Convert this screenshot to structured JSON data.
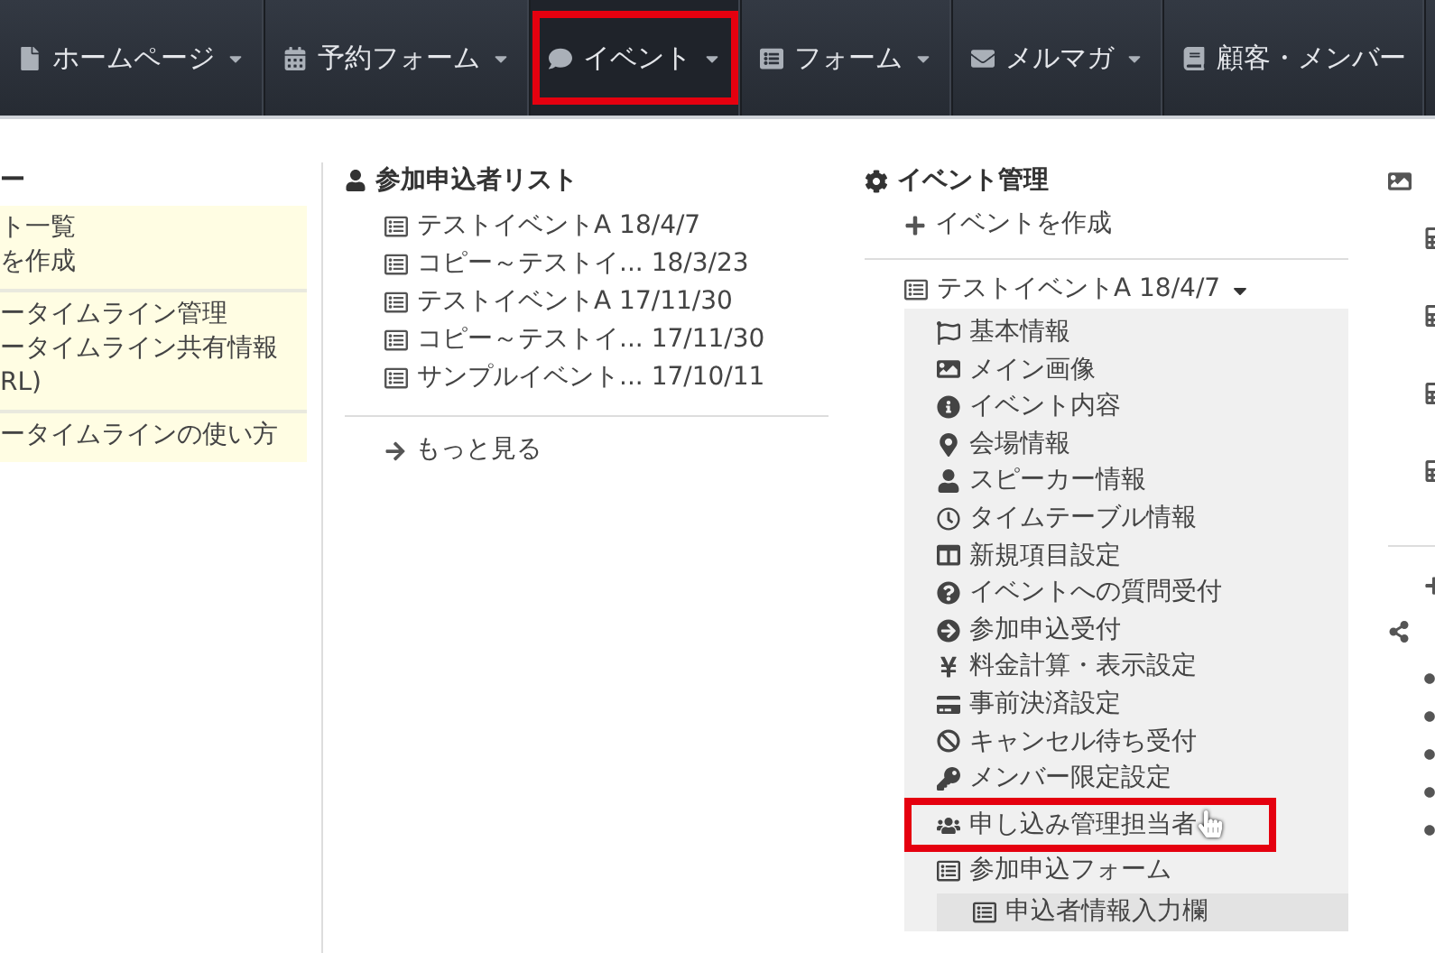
{
  "nav": {
    "items": [
      {
        "label": "ホームページ",
        "selected": false,
        "highlighted": false
      },
      {
        "label": "予約フォーム",
        "selected": false,
        "highlighted": false
      },
      {
        "label": "イベント",
        "selected": true,
        "highlighted": true
      },
      {
        "label": "フォーム",
        "selected": false,
        "highlighted": false
      },
      {
        "label": "メルマガ",
        "selected": false,
        "highlighted": false
      },
      {
        "label": "顧客・メンバー",
        "selected": false,
        "highlighted": false
      }
    ]
  },
  "left_column": {
    "heading": "ー",
    "groups": [
      [
        "ト一覧",
        "を作成"
      ],
      [
        "ータイムライン管理",
        "ータイムライン共有情報",
        "RL)"
      ],
      [
        "ータイムラインの使い方"
      ]
    ]
  },
  "applicant_list": {
    "title": "参加申込者リスト",
    "items": [
      {
        "name": "テストイベントA",
        "date": "18/4/7"
      },
      {
        "name": "コピー～テストイ...",
        "date": "18/3/23"
      },
      {
        "name": "テストイベントA",
        "date": "17/11/30"
      },
      {
        "name": "コピー～テストイ...",
        "date": "17/11/30"
      },
      {
        "name": "サンプルイベント...",
        "date": "17/10/11"
      }
    ],
    "more": "もっと見る"
  },
  "event_management": {
    "title": "イベント管理",
    "create": "イベントを作成",
    "event": {
      "label": "テストイベントA 18/4/7",
      "expanded": true,
      "items": [
        {
          "label": "基本情報",
          "highlighted": false
        },
        {
          "label": "メイン画像",
          "highlighted": false
        },
        {
          "label": "イベント内容",
          "highlighted": false
        },
        {
          "label": "会場情報",
          "highlighted": false
        },
        {
          "label": "スピーカー情報",
          "highlighted": false
        },
        {
          "label": "タイムテーブル情報",
          "highlighted": false
        },
        {
          "label": "新規項目設定",
          "highlighted": false
        },
        {
          "label": "イベントへの質問受付",
          "highlighted": false
        },
        {
          "label": "参加申込受付",
          "highlighted": false
        },
        {
          "label": "料金計算・表示設定",
          "highlighted": false
        },
        {
          "label": "事前決済設定",
          "highlighted": false
        },
        {
          "label": "キャンセル待ち受付",
          "highlighted": false
        },
        {
          "label": "メンバー限定設定",
          "highlighted": false
        },
        {
          "label": "申し込み管理担当者",
          "highlighted": true
        },
        {
          "label": "参加申込フォーム",
          "highlighted": false
        }
      ],
      "sub_items": [
        "申込者情報入力欄"
      ]
    }
  }
}
